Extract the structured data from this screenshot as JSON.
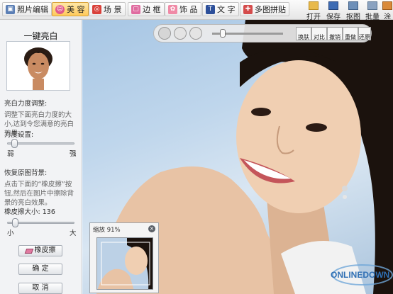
{
  "tabs": [
    {
      "label": "照片编辑",
      "icon": "photo-edit-icon"
    },
    {
      "label": "美 容",
      "icon": "beauty-icon"
    },
    {
      "label": "场 景",
      "icon": "scene-icon"
    },
    {
      "label": "边 框",
      "icon": "frame-icon"
    },
    {
      "label": "饰 品",
      "icon": "accessory-icon"
    },
    {
      "label": "文 字",
      "icon": "text-icon"
    },
    {
      "label": "多图拼贴",
      "icon": "collage-icon"
    }
  ],
  "tools": [
    {
      "label": "打开",
      "icon": "open-folder-icon"
    },
    {
      "label": "保存",
      "icon": "save-icon"
    },
    {
      "label": "抠图",
      "icon": "cutout-icon"
    },
    {
      "label": "批量",
      "icon": "batch-icon"
    },
    {
      "label": "涂鸦",
      "icon": "doodle-icon"
    }
  ],
  "panel": {
    "title": "一键亮白",
    "section1_title": "亮白力度调整:",
    "section1_desc": "调整下面亮白力度的大小,达到令您满意的亮白效果。",
    "strength_label": "力度设置:",
    "strength_min": "弱",
    "strength_max": "强",
    "strength_value": 0.1,
    "section2_title": "恢复原图背景:",
    "section2_desc": "点击下面的“橡皮擦”按钮,然后在图片中擦除背景的亮白效果。",
    "eraser_size_label": "橡皮擦大小:",
    "eraser_size_value": "136",
    "eraser_min": "小",
    "eraser_max": "大",
    "eraser_value": 0.12,
    "eraser_button": "橡皮擦",
    "confirm_button": "确 定",
    "cancel_button": "取 消"
  },
  "canvas_toolbar": {
    "zoom_slider_value": 0.15,
    "buttons": [
      "换肤",
      "对比",
      "撤销",
      "重做",
      "还原"
    ]
  },
  "zoom_popup": {
    "label": "缩放 91%"
  },
  "watermark": {
    "text": "ONLINEDOWN"
  },
  "colors": {
    "active_tab": "#ffc95a",
    "sky": "#bfd6ec"
  }
}
